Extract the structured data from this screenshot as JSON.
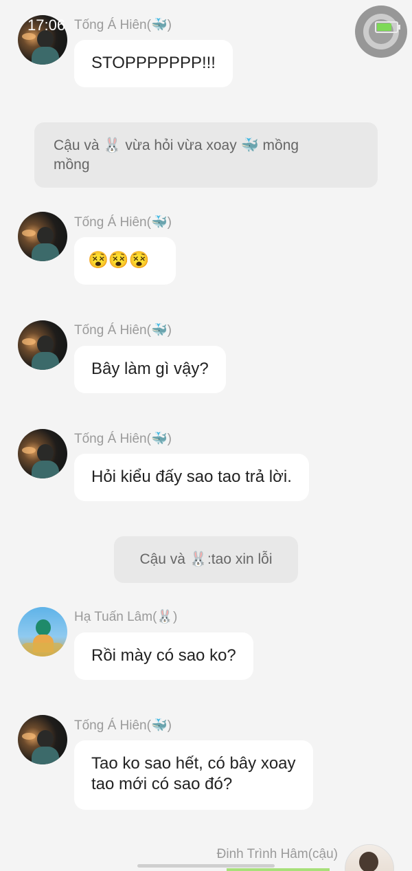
{
  "status_bar": {
    "time": "17:06",
    "battery_level": 0.75,
    "battery_color": "#7ed957"
  },
  "messages": [
    {
      "sender": "Tống Á Hiên(🐳)",
      "text": "STOPPPPPPP!!!"
    },
    {
      "sender": "Tống Á Hiên(🐳)",
      "text": "😵😵😵"
    },
    {
      "sender": "Tống Á Hiên(🐳)",
      "text": "Bây làm gì vậy?"
    },
    {
      "sender": "Tống Á Hiên(🐳)",
      "text": "Hỏi kiểu đấy sao tao trả lời."
    },
    {
      "sender": "Hạ Tuấn Lâm(🐰)",
      "text": "Rồi mày có sao ko?"
    },
    {
      "sender": "Tống Á Hiên(🐳)",
      "text_line1": "Tao ko sao hết, có bây xoay",
      "text_line2": "tao mới có sao đó?"
    },
    {
      "sender": "Đinh Trình Hâm(cậu)"
    }
  ],
  "system_notices": [
    {
      "line1": "Cậu và 🐰 vừa hỏi vừa xoay 🐳 mồng",
      "line2": "mồng"
    },
    {
      "text": "Cậu và 🐰:tao xin lỗi"
    }
  ]
}
